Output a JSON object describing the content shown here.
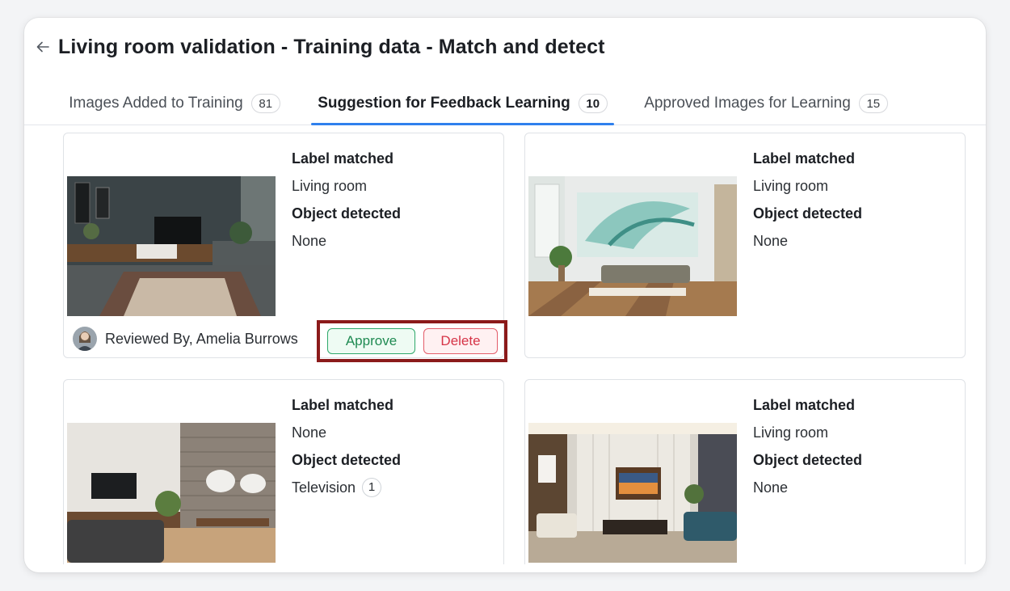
{
  "header": {
    "title": "Living room validation - Training data - Match and detect"
  },
  "tabs": [
    {
      "label": "Images Added to Training",
      "count": "81",
      "active": false
    },
    {
      "label": "Suggestion for Feedback Learning",
      "count": "10",
      "active": true
    },
    {
      "label": "Approved Images for Learning",
      "count": "15",
      "active": false
    }
  ],
  "labels": {
    "label_matched": "Label matched",
    "object_detected": "Object detected"
  },
  "cards": [
    {
      "label_value": "Living room",
      "object_value": "None",
      "object_count": null,
      "reviewed_by": "Reviewed By, Amelia Burrows",
      "approve": "Approve",
      "delete": "Delete"
    },
    {
      "label_value": "Living room",
      "object_value": "None",
      "object_count": null
    },
    {
      "label_value": "None",
      "object_value": "Television",
      "object_count": "1"
    },
    {
      "label_value": "Living room",
      "object_value": "None",
      "object_count": null
    }
  ],
  "colors": {
    "accent": "#2f80ed",
    "approve": "#1f8a52",
    "delete": "#d63447",
    "highlight_box": "#8b1a1a"
  }
}
